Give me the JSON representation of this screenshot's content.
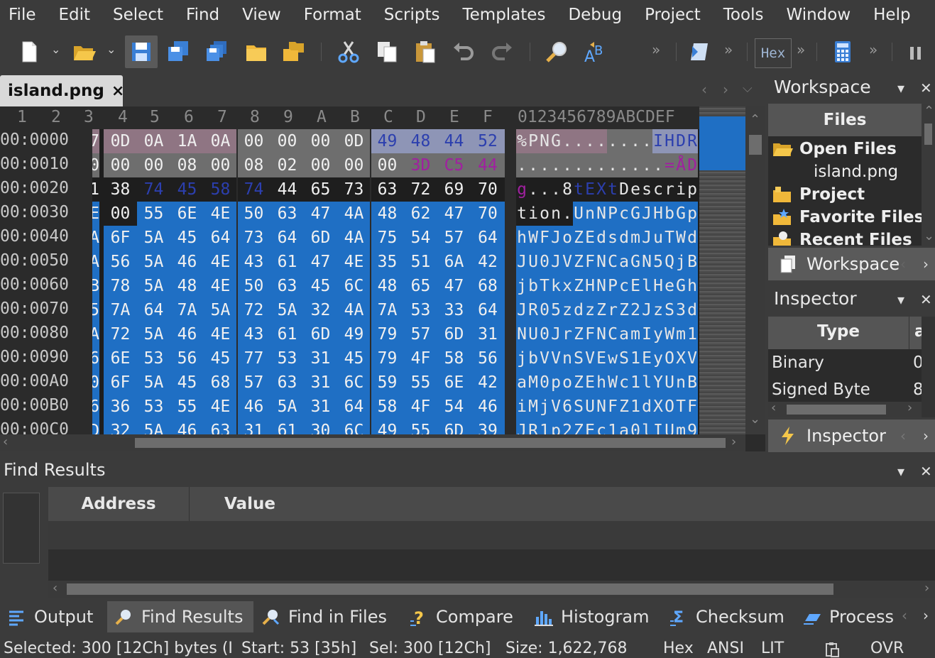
{
  "menu": [
    "File",
    "Edit",
    "Select",
    "Find",
    "View",
    "Format",
    "Scripts",
    "Templates",
    "Debug",
    "Project",
    "Tools",
    "Window",
    "Help"
  ],
  "toolbar": {
    "hex_label": "Hex",
    "icons": [
      "new-file-icon",
      "open-folder-icon",
      "save-icon",
      "save-as-icon",
      "save-all-icon",
      "folder-icon",
      "open-multiple-icon",
      "cut-icon",
      "copy-icon",
      "paste-icon",
      "undo-icon",
      "redo-icon",
      "find-icon",
      "replace-icon",
      "script-icon",
      "calculator-icon"
    ]
  },
  "document": {
    "tab_label": "island.png",
    "close_glyph": "×"
  },
  "hex": {
    "ruler": [
      "1",
      "2",
      "3",
      "4",
      "5",
      "6",
      "7",
      "8",
      "9",
      "A",
      "B",
      "C",
      "D",
      "E",
      "F"
    ],
    "ruler_ascii": "0123456789ABCDEF",
    "rows": [
      {
        "addr": "00:0000",
        "first": "7",
        "bytes": [
          "0D",
          "0A",
          "1A",
          "0A",
          "00",
          "00",
          "00",
          "0D",
          "49",
          "48",
          "44",
          "52"
        ],
        "ascii": "%PNG........IHDR"
      },
      {
        "addr": "00:0010",
        "first": "0",
        "bytes": [
          "00",
          "00",
          "08",
          "00",
          "08",
          "02",
          "00",
          "00",
          "00",
          "3D",
          "C5",
          "44"
        ],
        "ascii": ".............=ÅD"
      },
      {
        "addr": "00:0020",
        "first": "1",
        "bytes": [
          "38",
          "74",
          "45",
          "58",
          "74",
          "44",
          "65",
          "73",
          "63",
          "72",
          "69",
          "70"
        ],
        "ascii": "g...8tEXtDescrip"
      },
      {
        "addr": "00:0030",
        "first": "E",
        "bytes": [
          "00",
          "55",
          "6E",
          "4E",
          "50",
          "63",
          "47",
          "4A",
          "48",
          "62",
          "47",
          "70"
        ],
        "ascii": "tion.UnNPcGJHbGp"
      },
      {
        "addr": "00:0040",
        "first": "A",
        "bytes": [
          "6F",
          "5A",
          "45",
          "64",
          "73",
          "64",
          "6D",
          "4A",
          "75",
          "54",
          "57",
          "64"
        ],
        "ascii": "hWFJoZEdsdmJuTWd"
      },
      {
        "addr": "00:0050",
        "first": "A",
        "bytes": [
          "56",
          "5A",
          "46",
          "4E",
          "43",
          "61",
          "47",
          "4E",
          "35",
          "51",
          "6A",
          "42"
        ],
        "ascii": "JU0JVZFNCaGN5QjB"
      },
      {
        "addr": "00:0060",
        "first": "B",
        "bytes": [
          "78",
          "5A",
          "48",
          "4E",
          "50",
          "63",
          "45",
          "6C",
          "48",
          "65",
          "47",
          "68"
        ],
        "ascii": "jbTkxZHNPcElHeGh"
      },
      {
        "addr": "00:0070",
        "first": "5",
        "bytes": [
          "7A",
          "64",
          "7A",
          "5A",
          "72",
          "5A",
          "32",
          "4A",
          "7A",
          "53",
          "33",
          "64"
        ],
        "ascii": "JR05zdzZrZ2JzS3d"
      },
      {
        "addr": "00:0080",
        "first": "A",
        "bytes": [
          "72",
          "5A",
          "46",
          "4E",
          "43",
          "61",
          "6D",
          "49",
          "79",
          "57",
          "6D",
          "31"
        ],
        "ascii": "NU0JrZFNCamIyWm1"
      },
      {
        "addr": "00:0090",
        "first": "6",
        "bytes": [
          "6E",
          "53",
          "56",
          "45",
          "77",
          "53",
          "31",
          "45",
          "79",
          "4F",
          "58",
          "56"
        ],
        "ascii": "jbVVnSVEwS1EyOXV"
      },
      {
        "addr": "00:00A0",
        "first": "0",
        "bytes": [
          "6F",
          "5A",
          "45",
          "68",
          "57",
          "63",
          "31",
          "6C",
          "59",
          "55",
          "6E",
          "42"
        ],
        "ascii": "aM0poZEhWc1lYUnB"
      },
      {
        "addr": "00:00B0",
        "first": "6",
        "bytes": [
          "36",
          "53",
          "55",
          "4E",
          "46",
          "5A",
          "31",
          "64",
          "58",
          "4F",
          "54",
          "46"
        ],
        "ascii": "iMjV6SUNFZ1dXOTF"
      },
      {
        "addr": "00:00C0",
        "first": "D",
        "bytes": [
          "32",
          "5A",
          "46",
          "63",
          "31",
          "61",
          "30",
          "6C",
          "49",
          "55",
          "6D",
          "39"
        ],
        "ascii": "JR1p2ZEc1a0lIUm9"
      }
    ]
  },
  "workspace": {
    "title": "Workspace",
    "header": "Files",
    "items": [
      {
        "label": "Open Files",
        "bold": true
      },
      {
        "label": "island.png",
        "bold": false
      },
      {
        "label": "Project",
        "bold": true
      },
      {
        "label": "Favorite Files",
        "bold": true
      },
      {
        "label": "Recent Files",
        "bold": true
      }
    ],
    "tab_label": "Workspace"
  },
  "inspector": {
    "title": "Inspector",
    "col_type": "Type",
    "col_value_partial": "a",
    "rows": [
      {
        "type": "Binary",
        "value": "0"
      },
      {
        "type": "Signed Byte",
        "value": "8"
      }
    ],
    "tab_label": "Inspector"
  },
  "find_results": {
    "title": "Find Results",
    "columns": [
      "Address",
      "Value"
    ]
  },
  "bottom_tabs": [
    "Output",
    "Find Results",
    "Find in Files",
    "Compare",
    "Histogram",
    "Checksum",
    "Process"
  ],
  "status": {
    "selected": "Selected: 300 [12Ch] bytes (I",
    "start": "Start: 53 [35h]",
    "sel": "Sel: 300 [12Ch]",
    "size": "Size: 1,622,768",
    "mode": "Hex",
    "encoding": "ANSI",
    "endian": "LIT",
    "ovr": "OVR"
  },
  "colors": {
    "selection": "#1f6fc4",
    "header_pink": "#8f7583",
    "header_gray": "#6e6e6e",
    "header_blue": "#8e95b6",
    "keyword_purple": "#a020a0",
    "keyword_blue": "#2c3fae"
  }
}
